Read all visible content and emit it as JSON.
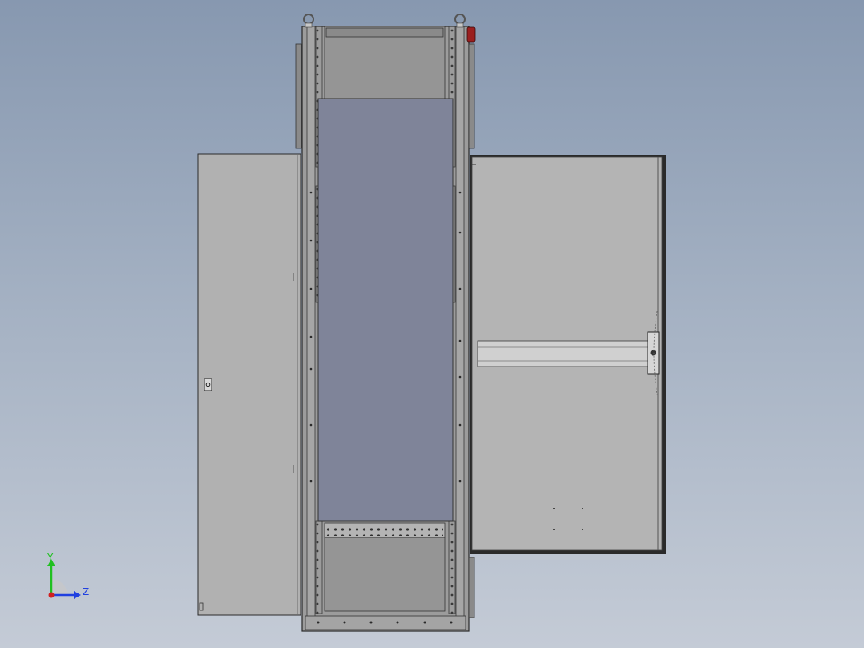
{
  "viewport": {
    "background_top": "#8798b0",
    "background_bottom": "#c4cbd6",
    "model": {
      "cabinet_frame_color": "#9c9c9c",
      "door_panel_color": "#b1b1b1",
      "mounting_plate_color": "#7f8499",
      "handle_color": "#d0d0d0",
      "marker_color": "#9a1f1f"
    }
  },
  "triad": {
    "y_label": "Y",
    "z_label": "Z",
    "y_color": "#20c020",
    "z_color": "#2040e0",
    "x_color": "#d02020"
  }
}
